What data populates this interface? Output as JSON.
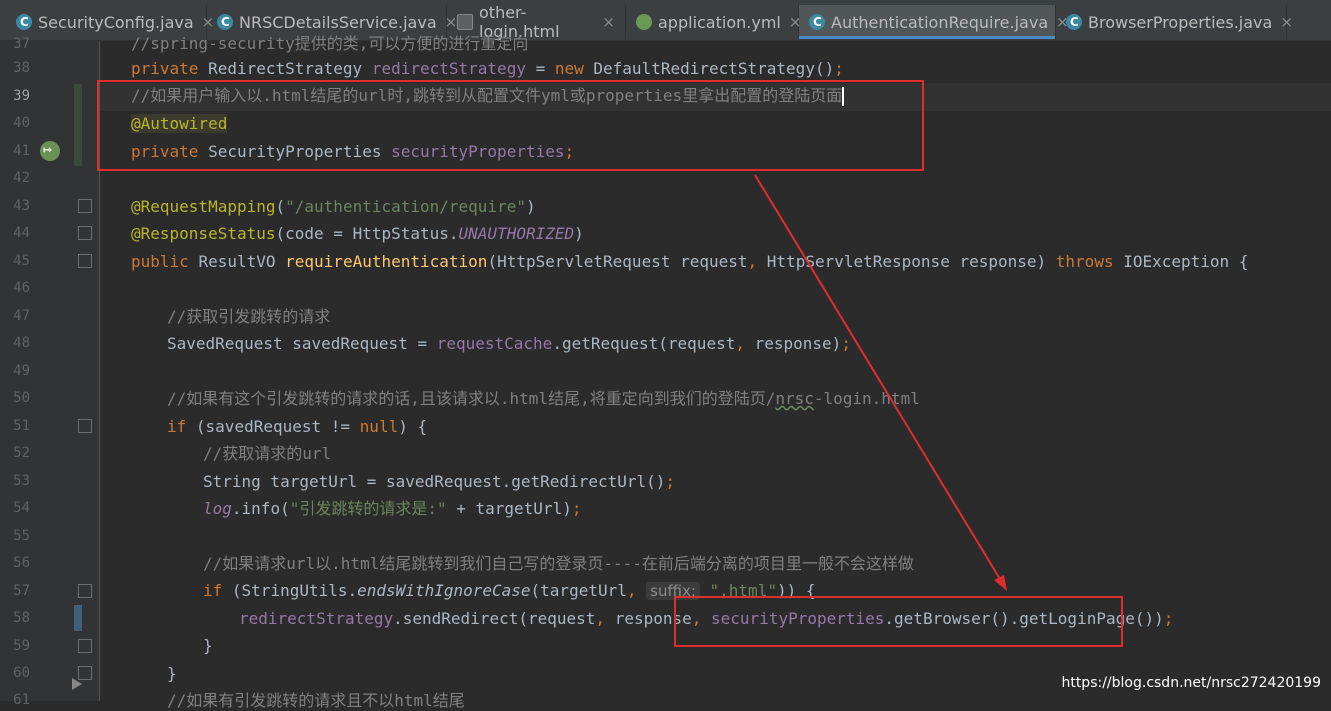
{
  "tabs": [
    {
      "label": "SecurityConfig.java",
      "icon": "java-class-icon"
    },
    {
      "label": "NRSCDetailsService.java",
      "icon": "java-class-icon"
    },
    {
      "label": "other-login.html",
      "icon": "html-file-icon"
    },
    {
      "label": "application.yml",
      "icon": "yml-file-icon"
    },
    {
      "label": "AuthenticationRequire.java",
      "icon": "java-class-icon"
    },
    {
      "label": "BrowserProperties.java",
      "icon": "java-class-icon"
    }
  ],
  "close_glyph": "×",
  "active_tab": 4,
  "line_numbers": [
    "37",
    "38",
    "39",
    "40",
    "41",
    "42",
    "43",
    "44",
    "45",
    "46",
    "47",
    "48",
    "49",
    "50",
    "51",
    "52",
    "53",
    "54",
    "55",
    "56",
    "57",
    "58",
    "59",
    "60",
    "61"
  ],
  "code": {
    "l37_comment": "//spring-security提供的类,可以方便的进行重定向",
    "l38_kw": "private ",
    "l38_type": "RedirectStrategy ",
    "l38_field": "redirectStrategy",
    "l38_eq": " = ",
    "l38_new": "new ",
    "l38_ctor": "DefaultRedirectStrategy()",
    "l38_semi": ";",
    "l39_comment": "//如果用户输入以.html结尾的url时,跳转到从配置文件yml或properties里拿出配置的登陆页面",
    "l40_annot": "@Autowired",
    "l41_kw": "private ",
    "l41_type": "SecurityProperties ",
    "l41_field": "securityProperties",
    "l41_semi": ";",
    "l43_annot": "@RequestMapping",
    "l43_open": "(",
    "l43_str": "\"/authentication/require\"",
    "l43_close": ")",
    "l44_annot": "@ResponseStatus",
    "l44_mid": "(code = HttpStatus.",
    "l44_const": "UNAUTHORIZED",
    "l44_close": ")",
    "l45_kw": "public ",
    "l45_type": "ResultVO ",
    "l45_method": "requireAuthentication",
    "l45_params": "(HttpServletRequest request",
    "l45_comma": ", ",
    "l45_params2": "HttpServletResponse response) ",
    "l45_throws": "throws ",
    "l45_exc": "IOException {",
    "l47_comment": "//获取引发跳转的请求",
    "l48_a": "SavedRequest savedRequest = ",
    "l48_field": "requestCache",
    "l48_b": ".getRequest(request",
    "l48_comma": ", ",
    "l48_c": "response)",
    "l48_semi": ";",
    "l50_comment_a": "//如果有这个引发跳转的请求的话,且该请求以.html结尾,将重定向到我们的登陆页/",
    "l50_comment_squig": "nrsc",
    "l50_comment_b": "-login.html",
    "l51_kw": "if ",
    "l51_a": "(savedRequest != ",
    "l51_null": "null",
    "l51_b": ") {",
    "l52_comment": "//获取请求的url",
    "l53_a": "String targetUrl = savedRequest.getRedirectUrl()",
    "l53_semi": ";",
    "l54_log": "log",
    "l54_a": ".info(",
    "l54_str": "\"引发跳转的请求是:\"",
    "l54_b": " + targetUrl)",
    "l54_semi": ";",
    "l56_comment": "//如果请求url以.html结尾跳转到我们自己写的登录页----在前后端分离的项目里一般不会这样做",
    "l57_kw": "if ",
    "l57_a": "(StringUtils.",
    "l57_method": "endsWithIgnoreCase",
    "l57_b": "(targetUrl",
    "l57_comma": ", ",
    "l57_hint": "suffix:",
    "l57_str": " \".html\"",
    "l57_c": ")) {",
    "l58_field": "redirectStrategy",
    "l58_a": ".sendRedirect(request",
    "l58_comma1": ", ",
    "l58_b": "response",
    "l58_comma2": ", ",
    "l58_field2": "securityProperties",
    "l58_c": ".getBrowser().getLoginPage())",
    "l58_semi": ";",
    "l59": "}",
    "l60": "}",
    "l61_comment": "//如果有引发跳转的请求且不以html结尾"
  },
  "watermark": "https://blog.csdn.net/nrsc272420199",
  "colors": {
    "annotation_box": "#e02e2e",
    "arrow": "#e02e2e"
  }
}
